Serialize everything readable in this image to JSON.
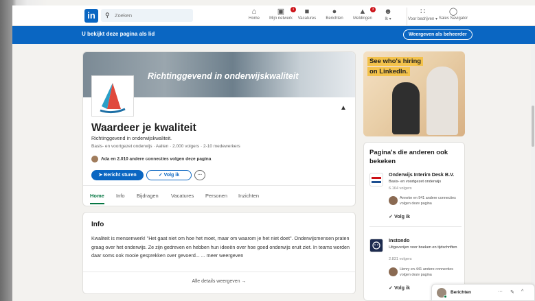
{
  "nav": {
    "search_placeholder": "Zoeken",
    "items": [
      {
        "label": "Home",
        "icon": "home-icon",
        "badge": ""
      },
      {
        "label": "Mijn netwerk",
        "icon": "network-icon",
        "badge": "1"
      },
      {
        "label": "Vacatures",
        "icon": "briefcase-icon",
        "badge": ""
      },
      {
        "label": "Berichten",
        "icon": "chat-icon",
        "badge": ""
      },
      {
        "label": "Meldingen",
        "icon": "bell-icon",
        "badge": "3"
      },
      {
        "label": "Ik ▾",
        "icon": "me-avatar",
        "badge": ""
      },
      {
        "label": "Voor bedrijven ▾",
        "icon": "grid-icon",
        "badge": ""
      },
      {
        "label": "Sales Navigator",
        "icon": "compass-icon",
        "badge": ""
      }
    ]
  },
  "admin_bar": {
    "text": "U bekijkt deze pagina als lid",
    "button": "Weergeven als beheerder"
  },
  "company": {
    "cover_tagline": "Richtinggevend in onderwijskwaliteit",
    "name": "Waardeer je kwaliteit",
    "tagline": "Richtinggevend in onderwijskwaliteit.",
    "meta": "Basis- en voortgezet onderwijs · Aalten · 2.000 volgers · 2-10 medewerkers",
    "connections": "Ada en 2.010 andere connecties volgen deze pagina",
    "btn_message": "➤ Bericht sturen",
    "btn_follow": "✓ Volg ik",
    "btn_more": "···",
    "tabs": [
      "Home",
      "Info",
      "Bijdragen",
      "Vacatures",
      "Personen",
      "Inzichten"
    ]
  },
  "info": {
    "heading": "Info",
    "text": "Kwaliteit is mensenwerk! \"Het gaat niet om hoe het moet, maar om waarom je het niet doet\". Onderwijsmensen praten graag over het onderwijs. Ze zijn gedreven en hebben hun ideeën over hoe goed onderwijs eruit ziet. In teams worden daar soms ook mooie gesprekken over gevoerd... ... meer weergeven",
    "footer": "Alle details weergeven →"
  },
  "ad": {
    "line1": "See who's hiring",
    "line2": "on LinkedIn."
  },
  "sidebar": {
    "title": "Pagina's die anderen ook bekeken",
    "companies": [
      {
        "name": "Onderwijs Interim Desk B.V.",
        "desc": "Basis- en voortgezet onderwijs",
        "followers": "6.164 volgers",
        "mutual": "Anneke en 941 andere connecties volgen deze pagina",
        "follow": "✓ Volg ik"
      },
      {
        "name": "Instondo",
        "desc": "Uitgeverijen voor boeken en tijdschriften",
        "followers": "2.831 volgers",
        "mutual": "Henry en 441 andere connecties volgen deze pagina",
        "follow": "✓ Volg ik"
      }
    ]
  },
  "messaging": {
    "label": "Berichten",
    "more": "···",
    "compose": "✎",
    "collapse": "^"
  },
  "colors": {
    "brand": "#0a66c2",
    "active_tab": "#057642",
    "badge": "#cc1016"
  }
}
